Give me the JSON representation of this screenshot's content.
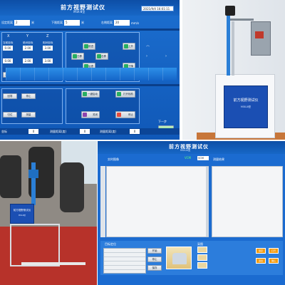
{
  "control_app": {
    "title": "前方视野测试仪",
    "subtitle": "MSK-Ⅲ型",
    "datetime": "2021/9/4 16:01:11",
    "params": [
      {
        "label": "设定距离",
        "value": "2",
        "unit": "米"
      },
      {
        "label": "下限距离",
        "value": "5",
        "unit": "米"
      },
      {
        "label": "右侧距离",
        "value": "20",
        "unit": "mm/s"
      }
    ],
    "columns": [
      {
        "header": "X",
        "value1": "0.00",
        "value2": "0.00",
        "btn": "X回零"
      },
      {
        "header": "Y",
        "value1": "2.00",
        "value2": "2.00",
        "btn": "Y回零"
      },
      {
        "header": "Z",
        "value1": "3.00",
        "value2": "3.00",
        "btn": "Z回零"
      }
    ],
    "field_labels": [
      "当前坐标",
      "绝对坐标",
      "相对坐标"
    ],
    "motion_buttons": [
      "前进",
      "上升",
      "左移",
      "右移",
      "下降",
      "后退"
    ],
    "lower_buttons": [
      "回零",
      "停止",
      "归位",
      "测量"
    ],
    "right_buttons": [
      "一键启动",
      "打开相机",
      "关闭",
      "停止"
    ],
    "status": [
      {
        "label": "坐标",
        "value": "0"
      },
      {
        "label": "测量距离(度)",
        "value": "0"
      },
      {
        "label": "测量距离(度)",
        "value": "0"
      }
    ],
    "next_label": "下一步"
  },
  "device_photo": {
    "plate_title": "前方视野测试仪",
    "plate_model": "MSK-Ⅲ型"
  },
  "vehicle_photo": {
    "plate_title": "前方视野测试仪",
    "plate_model": "MSK-Ⅲ型"
  },
  "measure_app": {
    "title": "前方视野测试仪",
    "subtitle": "MSK-Ⅲ型",
    "left_header": "实时图像",
    "right_header": "测量结果",
    "tab_label": "VCM",
    "tab_value": "VCM",
    "lower_header": "目标定位",
    "table_rows": [
      "",
      "",
      "",
      "",
      ""
    ],
    "lower_buttons": [
      "开始",
      "停止",
      "保存"
    ],
    "preview_label": "采图",
    "right_buttons": [
      "保存",
      "打开",
      "退出",
      "确认"
    ]
  }
}
